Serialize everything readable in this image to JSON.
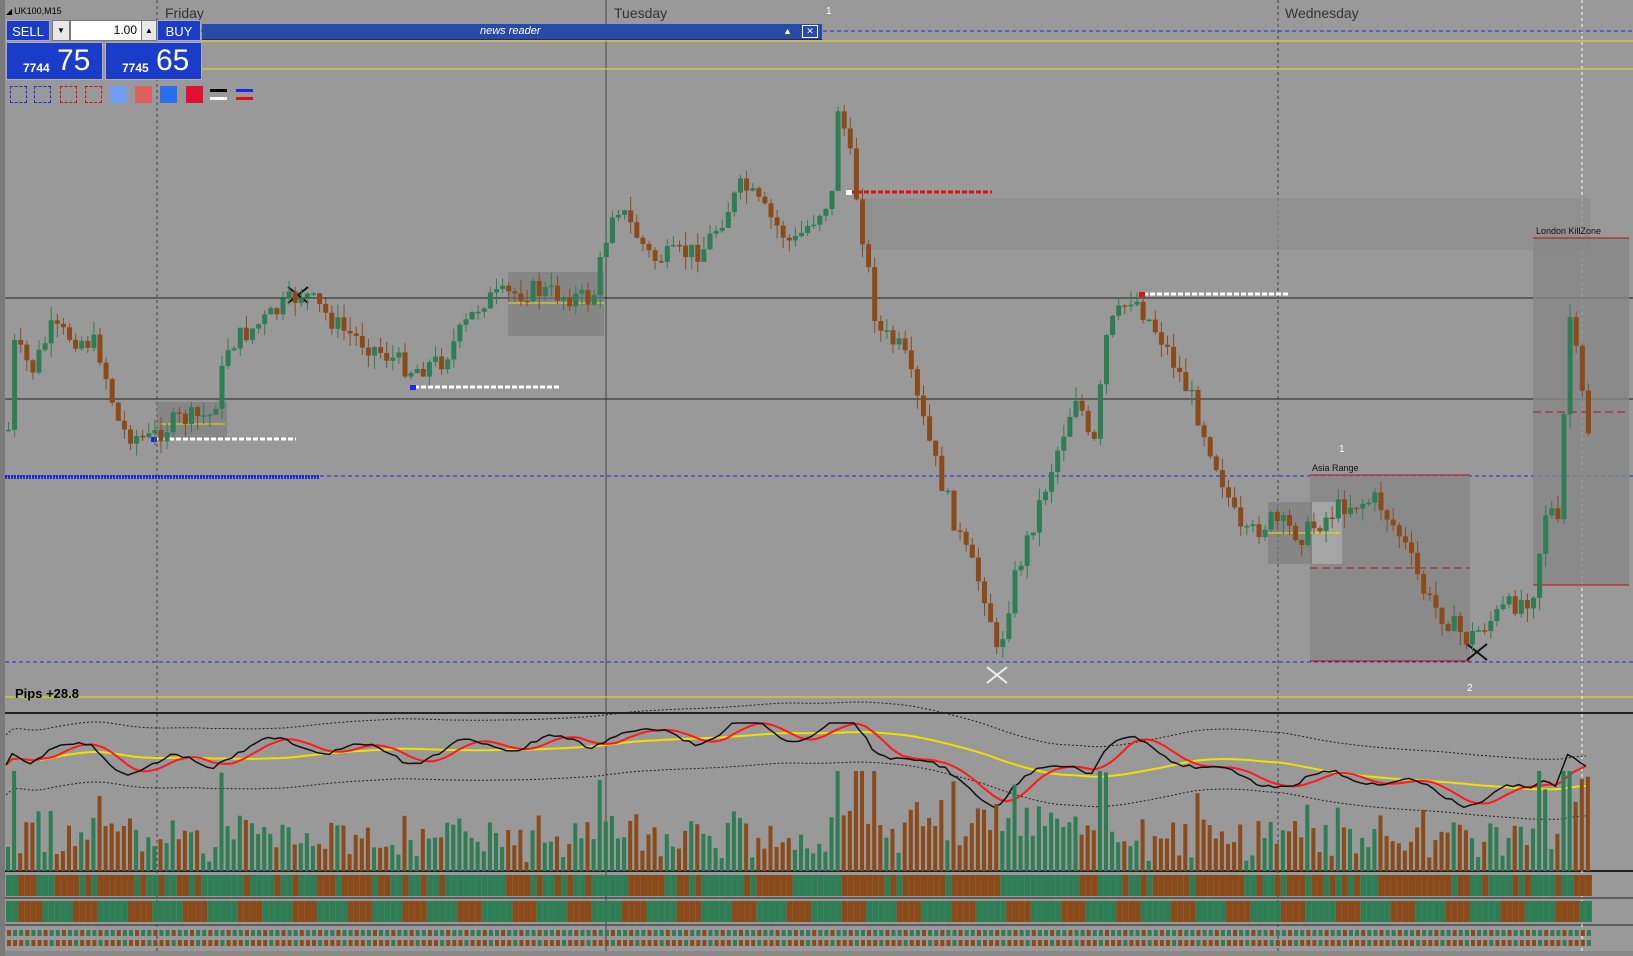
{
  "window": {
    "symbol": "UK100,M15"
  },
  "trade_panel": {
    "sell_label": "SELL",
    "buy_label": "BUY",
    "volume": "1.00",
    "sell_price_small": "7744",
    "sell_price_big": "75",
    "buy_price_small": "7745",
    "buy_price_big": "65"
  },
  "news_reader": {
    "title": "news reader"
  },
  "days": [
    "Friday",
    "Tuesday",
    "Wednesday"
  ],
  "markers": {
    "top_one": "1",
    "asia_one": "1",
    "asia_two": "2"
  },
  "labels": {
    "asia_range": "Asia Range",
    "london_killzone": "London KillZone"
  },
  "pips": "Pips +28.8",
  "colors": {
    "bg": "#999999",
    "bull": "#2e7d55",
    "bear": "#8b4a1a",
    "red": "#ff1a1a",
    "yellow": "#f0e000",
    "blue": "#1a2adf"
  },
  "tool_icons": [
    "blue-dashed-rect-icon",
    "blue-dashed-rect-icon",
    "red-dashed-rect-icon",
    "red-dashed-rect-icon",
    "light-blue-square-icon",
    "light-red-square-icon",
    "blue-square-icon",
    "red-square-icon",
    "white-black-lines-icon",
    "blue-red-lines-icon"
  ]
}
